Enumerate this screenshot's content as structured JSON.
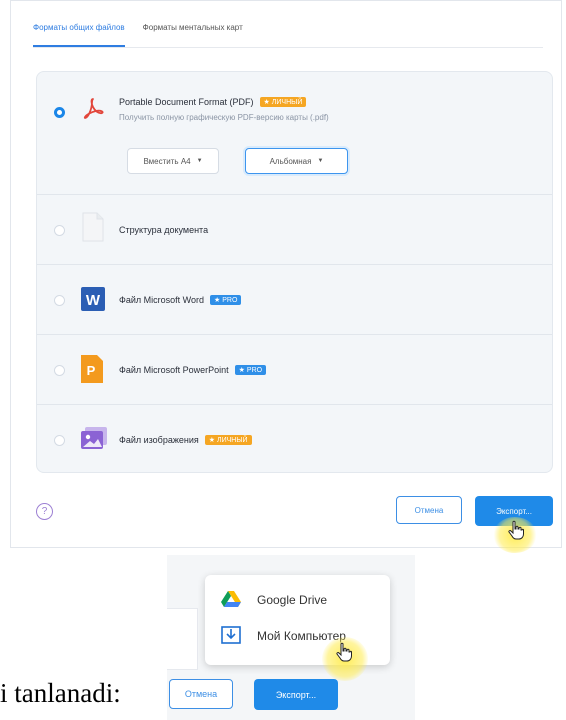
{
  "tabs": [
    {
      "label": "Форматы общих файлов",
      "active": true
    },
    {
      "label": "Форматы ментальных карт",
      "active": false
    }
  ],
  "formats": {
    "pdf": {
      "title": "Portable Document Format (PDF)",
      "badge": "ЛИЧНЫЙ",
      "subtitle": "Получить полную графическую PDF-версию карты (.pdf)",
      "selected": true,
      "page_size": "Вместить А4",
      "orientation": "Альбомная"
    },
    "outline": {
      "title": "Структура документа"
    },
    "word": {
      "title": "Файл Microsoft Word",
      "badge": "PRO"
    },
    "powerpoint": {
      "title": "Файл Microsoft PowerPoint",
      "badge": "PRO"
    },
    "image": {
      "title": "Файл изображения",
      "badge": "ЛИЧНЫЙ"
    }
  },
  "footer": {
    "help": "?",
    "cancel_label": "Отмена",
    "export_label": "Экспорт..."
  },
  "export_menu": {
    "items": [
      {
        "label": "Google Drive",
        "icon": "google-drive-icon"
      },
      {
        "label": "Мой Компьютер",
        "icon": "download-icon"
      }
    ],
    "cancel_label": "Отмена",
    "export_label": "Экспорт..."
  },
  "caption": "i tanlanadi:",
  "colors": {
    "accent": "#1f8ae8",
    "badge_personal": "#f5a623",
    "badge_pro": "#2f8fe8",
    "cursor_highlight": "#ffec50"
  }
}
